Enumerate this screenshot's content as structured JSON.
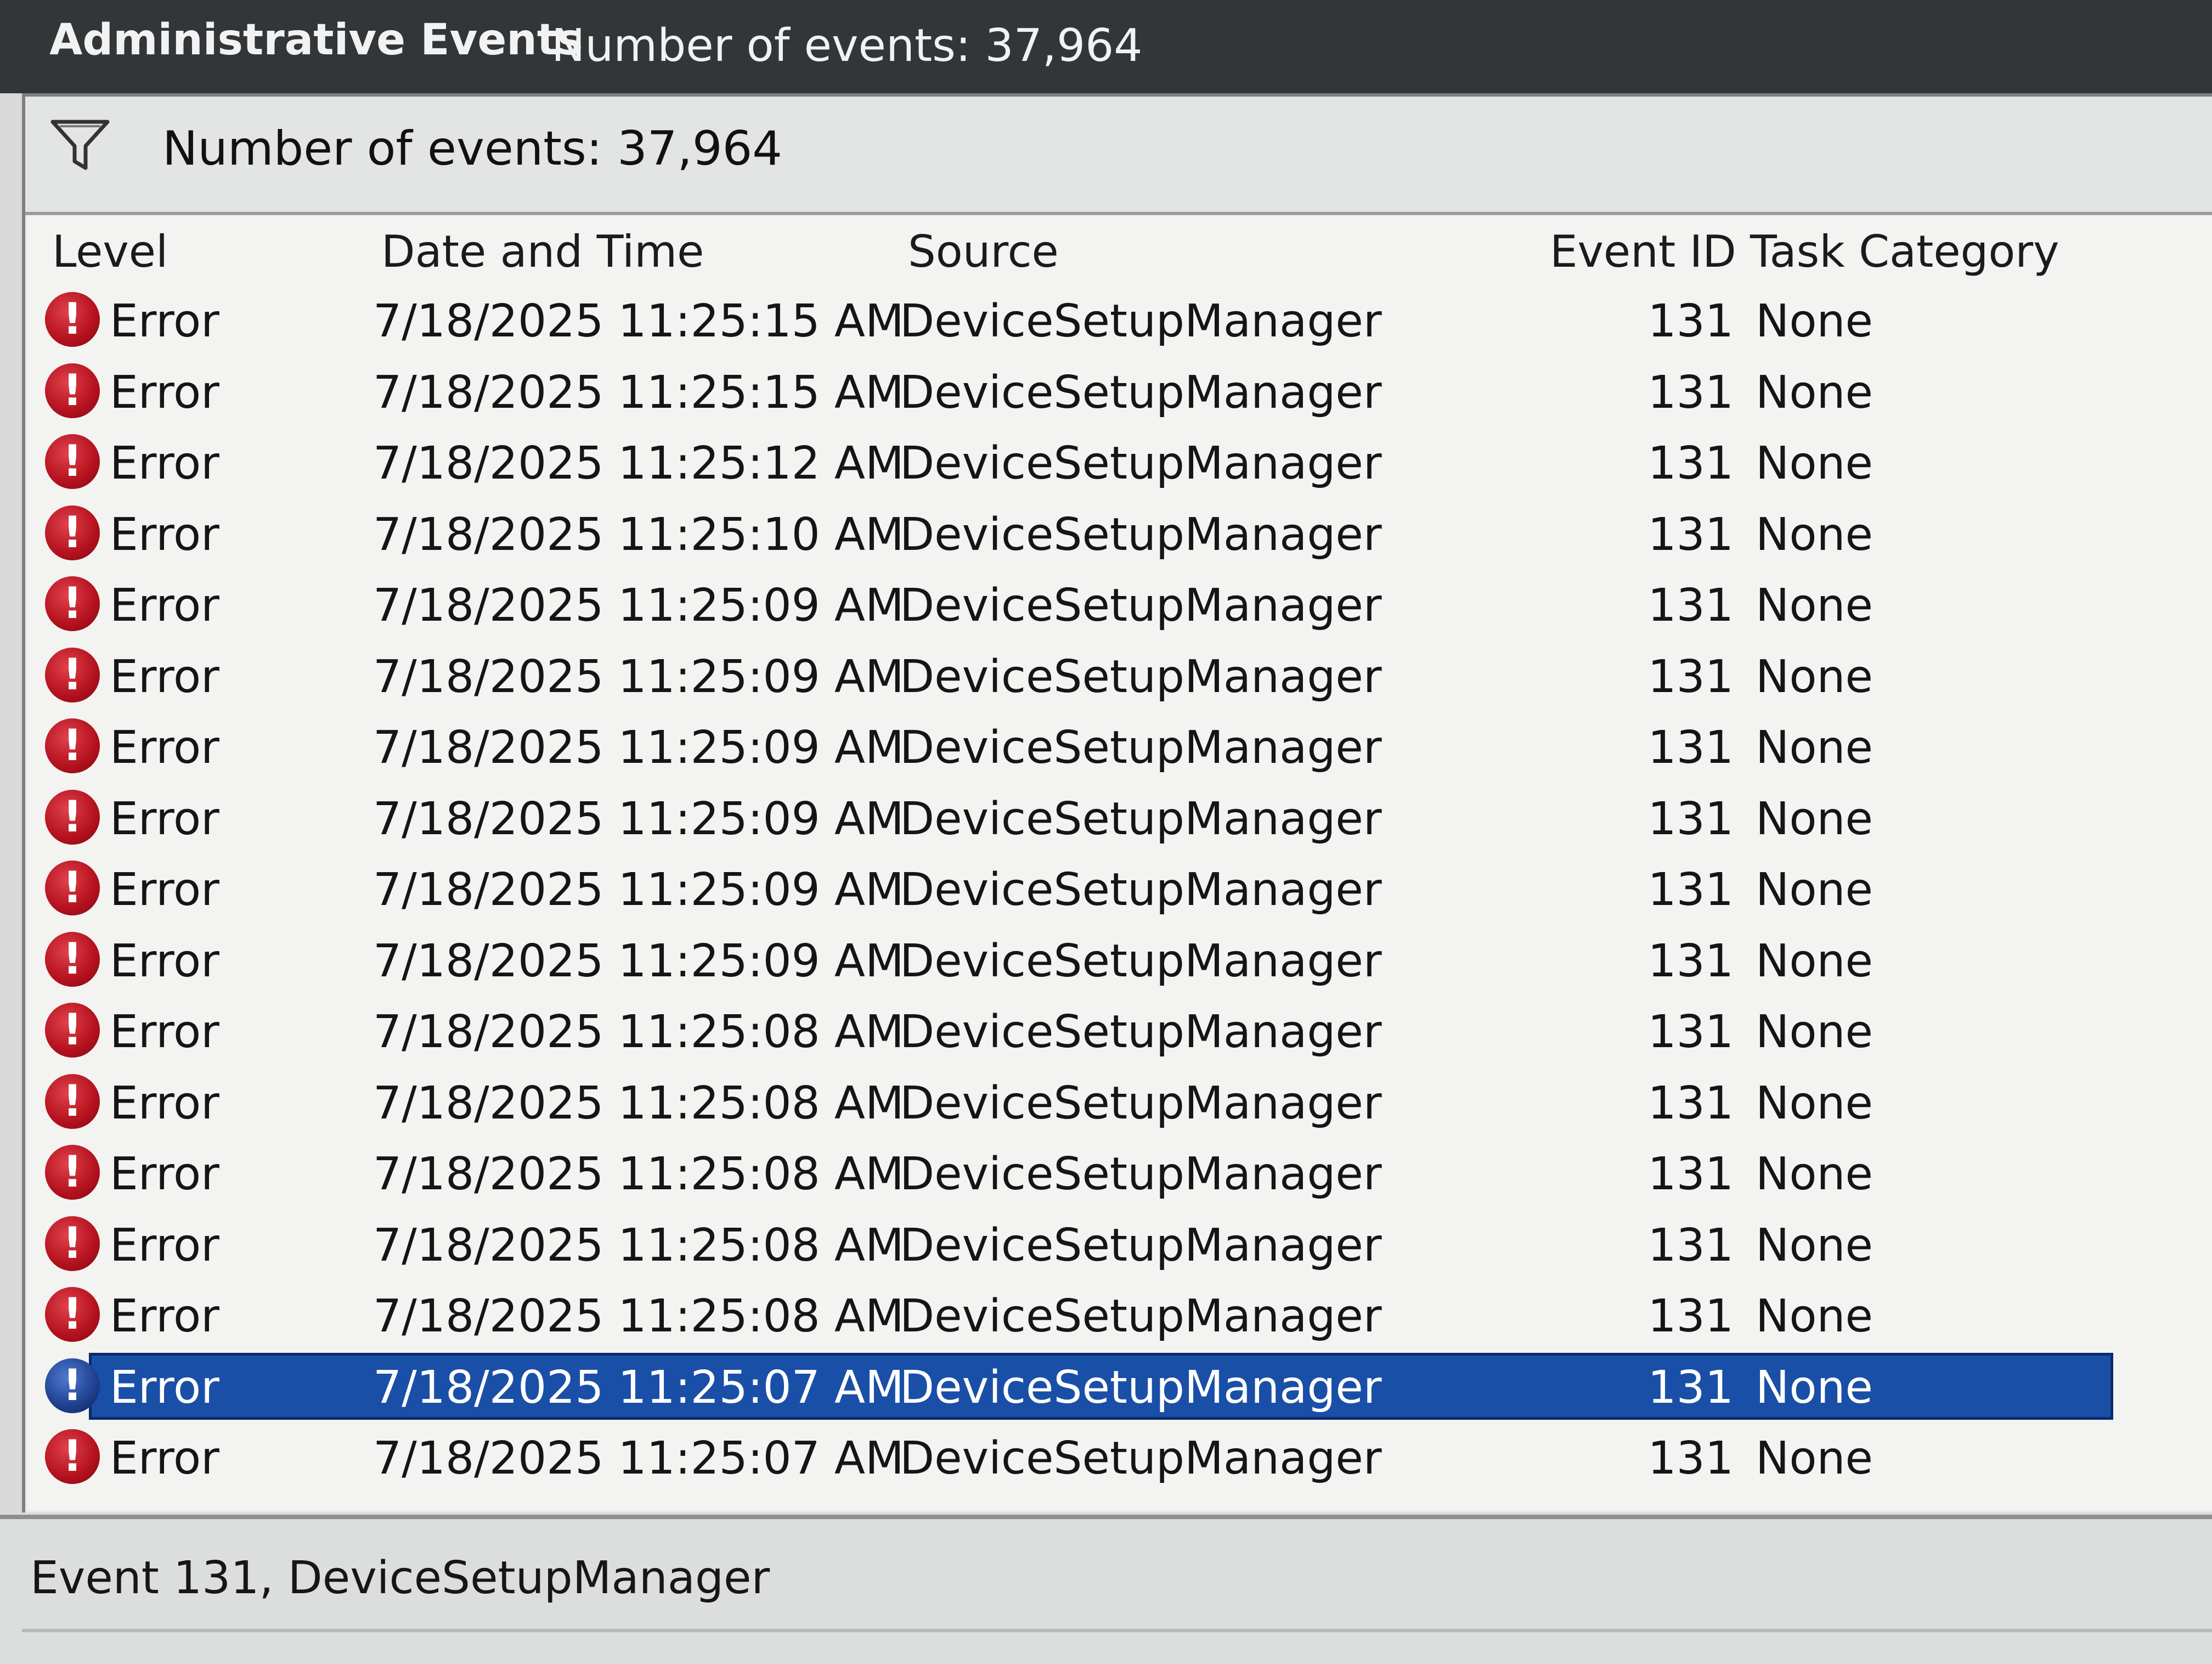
{
  "header": {
    "title": "Administrative Events",
    "count_text": "Number of events: 37,964"
  },
  "filter": {
    "icon": "filter-funnel-icon",
    "label": "Number of events: 37,964"
  },
  "columns": [
    "Level",
    "Date and Time",
    "Source",
    "Event ID",
    "Task Category"
  ],
  "rows": [
    {
      "level": "Error",
      "datetime": "7/18/2025 11:25:15 AM",
      "source": "DeviceSetupManager",
      "event_id": "131",
      "task": "None"
    },
    {
      "level": "Error",
      "datetime": "7/18/2025 11:25:15 AM",
      "source": "DeviceSetupManager",
      "event_id": "131",
      "task": "None"
    },
    {
      "level": "Error",
      "datetime": "7/18/2025 11:25:12 AM",
      "source": "DeviceSetupManager",
      "event_id": "131",
      "task": "None"
    },
    {
      "level": "Error",
      "datetime": "7/18/2025 11:25:10 AM",
      "source": "DeviceSetupManager",
      "event_id": "131",
      "task": "None"
    },
    {
      "level": "Error",
      "datetime": "7/18/2025 11:25:09 AM",
      "source": "DeviceSetupManager",
      "event_id": "131",
      "task": "None"
    },
    {
      "level": "Error",
      "datetime": "7/18/2025 11:25:09 AM",
      "source": "DeviceSetupManager",
      "event_id": "131",
      "task": "None"
    },
    {
      "level": "Error",
      "datetime": "7/18/2025 11:25:09 AM",
      "source": "DeviceSetupManager",
      "event_id": "131",
      "task": "None"
    },
    {
      "level": "Error",
      "datetime": "7/18/2025 11:25:09 AM",
      "source": "DeviceSetupManager",
      "event_id": "131",
      "task": "None"
    },
    {
      "level": "Error",
      "datetime": "7/18/2025 11:25:09 AM",
      "source": "DeviceSetupManager",
      "event_id": "131",
      "task": "None"
    },
    {
      "level": "Error",
      "datetime": "7/18/2025 11:25:09 AM",
      "source": "DeviceSetupManager",
      "event_id": "131",
      "task": "None"
    },
    {
      "level": "Error",
      "datetime": "7/18/2025 11:25:08 AM",
      "source": "DeviceSetupManager",
      "event_id": "131",
      "task": "None"
    },
    {
      "level": "Error",
      "datetime": "7/18/2025 11:25:08 AM",
      "source": "DeviceSetupManager",
      "event_id": "131",
      "task": "None"
    },
    {
      "level": "Error",
      "datetime": "7/18/2025 11:25:08 AM",
      "source": "DeviceSetupManager",
      "event_id": "131",
      "task": "None"
    },
    {
      "level": "Error",
      "datetime": "7/18/2025 11:25:08 AM",
      "source": "DeviceSetupManager",
      "event_id": "131",
      "task": "None"
    },
    {
      "level": "Error",
      "datetime": "7/18/2025 11:25:08 AM",
      "source": "DeviceSetupManager",
      "event_id": "131",
      "task": "None"
    },
    {
      "level": "Error",
      "datetime": "7/18/2025 11:25:07 AM",
      "source": "DeviceSetupManager",
      "event_id": "131",
      "task": "None",
      "selected": true
    },
    {
      "level": "Error",
      "datetime": "7/18/2025 11:25:07 AM",
      "source": "DeviceSetupManager",
      "event_id": "131",
      "task": "None"
    }
  ],
  "row_icon": "error-icon",
  "row_icon_glyph": "!",
  "colors": {
    "selection": "#1a4fa8",
    "error_icon": "#b3111d"
  },
  "detail": {
    "caption": "Event 131, DeviceSetupManager"
  }
}
